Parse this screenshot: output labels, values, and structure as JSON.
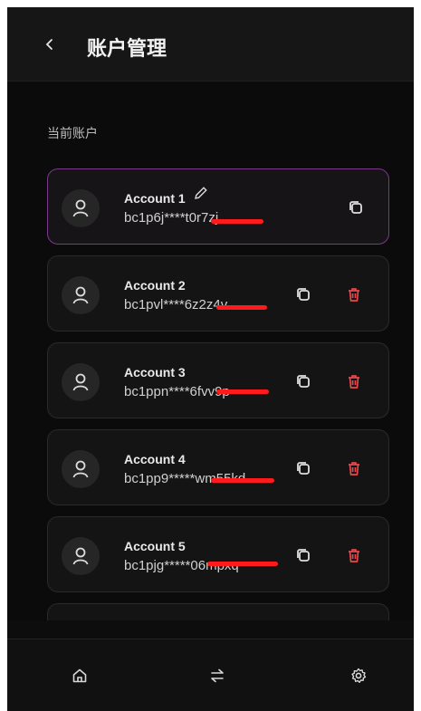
{
  "header": {
    "title": "账户管理"
  },
  "section": {
    "label": "当前账户"
  },
  "accounts": [
    {
      "name": "Account 1",
      "address": "bc1p6j****t0r7zj",
      "active": true
    },
    {
      "name": "Account 2",
      "address": "bc1pvl****6z2z4v",
      "active": false
    },
    {
      "name": "Account 3",
      "address": "bc1ppn****6fvv9p",
      "active": false
    },
    {
      "name": "Account 4",
      "address": "bc1pp9*****wm55kd",
      "active": false
    },
    {
      "name": "Account 5",
      "address": "bc1pjg*****06mpxq",
      "active": false
    }
  ],
  "colors": {
    "accent_border": "#7a3a8c",
    "delete": "#e5484d",
    "redaction": "#ff1b1b"
  },
  "icons": {
    "back": "chevron-left-icon",
    "edit": "pencil-icon",
    "copy": "copy-icon",
    "delete": "trash-icon",
    "home": "home-icon",
    "swap": "swap-icon",
    "settings": "gear-icon"
  }
}
